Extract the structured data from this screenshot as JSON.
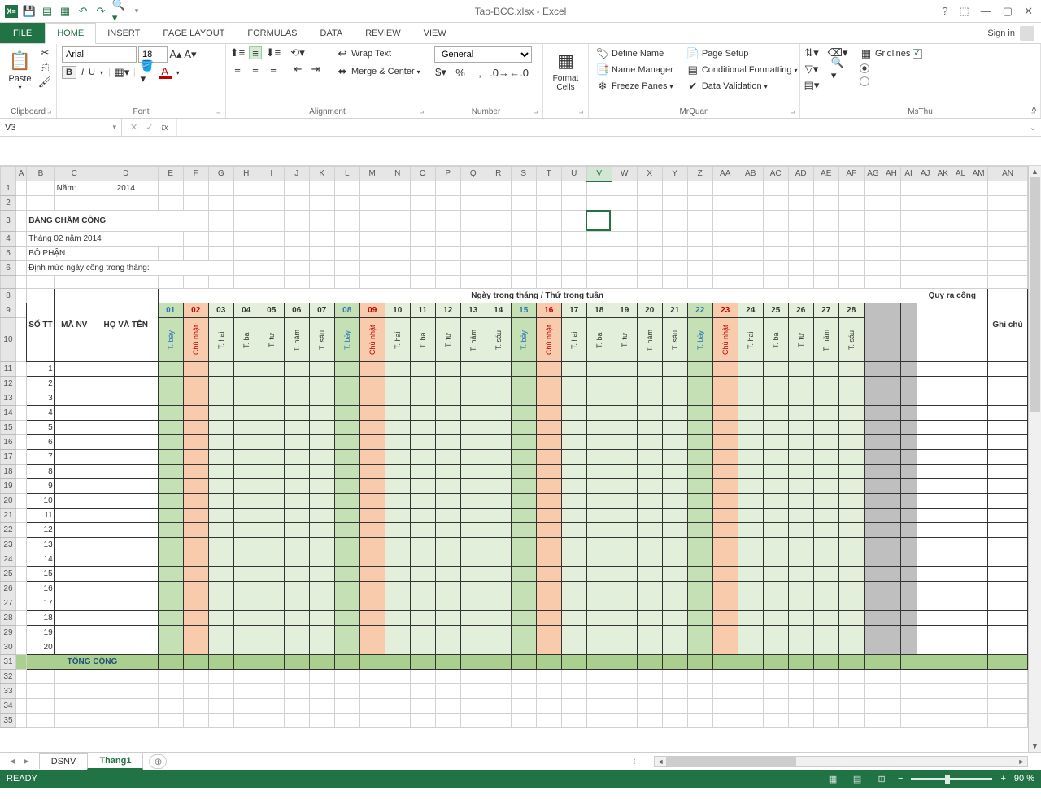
{
  "app": {
    "title": "Tao-BCC.xlsx - Excel",
    "signin": "Sign in"
  },
  "qat": {
    "save": "💾",
    "undo": "↶",
    "redo": "↷"
  },
  "tabs": [
    "FILE",
    "HOME",
    "INSERT",
    "PAGE LAYOUT",
    "FORMULAS",
    "DATA",
    "REVIEW",
    "VIEW"
  ],
  "ribbon": {
    "clipboard": {
      "label": "Clipboard",
      "paste": "Paste"
    },
    "font": {
      "label": "Font",
      "name": "Arial",
      "size": "18"
    },
    "alignment": {
      "label": "Alignment",
      "wrap": "Wrap Text",
      "merge": "Merge & Center"
    },
    "number": {
      "label": "Number",
      "format": "General"
    },
    "cells": {
      "label": "",
      "format": "Format Cells"
    },
    "mrquan": {
      "label": "MrQuan",
      "define": "Define Name",
      "mgr": "Name Manager",
      "freeze": "Freeze Panes",
      "pgsetup": "Page Setup",
      "condfmt": "Conditional Formatting",
      "dataval": "Data Validation"
    },
    "msthu": {
      "label": "MsThu",
      "grid": "Gridlines"
    }
  },
  "fbar": {
    "name": "V3",
    "fx": "fx"
  },
  "sheet": {
    "cols": [
      "A",
      "B",
      "C",
      "D",
      "E",
      "F",
      "G",
      "H",
      "I",
      "J",
      "K",
      "L",
      "M",
      "N",
      "O",
      "P",
      "Q",
      "R",
      "S",
      "T",
      "U",
      "V",
      "W",
      "X",
      "Y",
      "Z",
      "AA",
      "AB",
      "AC",
      "AD",
      "AE",
      "AF",
      "AG",
      "AH",
      "AI",
      "AJ",
      "AK",
      "AL",
      "AM",
      "AN"
    ],
    "r1_nam": "Năm:",
    "r1_year": "2014",
    "title": "BẢNG CHẤM CÔNG",
    "subtitle": "Tháng 02 năm 2014",
    "bophan": "BỘ PHẬN",
    "dinhmuc": "Định mức ngày công trong tháng:",
    "hdr_daymonth": "Ngày trong tháng / Thứ trong tuần",
    "hdr_quy": "Quy ra công",
    "hdr_stt": "SỐ TT",
    "hdr_manv": "MÃ NV",
    "hdr_hoten": "HỌ VÀ TÊN",
    "hdr_ghichu": "Ghi chú",
    "days": [
      {
        "n": "01",
        "t": "T. bảy",
        "cls": "sat"
      },
      {
        "n": "02",
        "t": "Chủ nhật",
        "cls": "sun"
      },
      {
        "n": "03",
        "t": "T. hai",
        "cls": "wd"
      },
      {
        "n": "04",
        "t": "T. ba",
        "cls": "wd"
      },
      {
        "n": "05",
        "t": "T. tư",
        "cls": "wd"
      },
      {
        "n": "06",
        "t": "T. năm",
        "cls": "wd"
      },
      {
        "n": "07",
        "t": "T. sáu",
        "cls": "wd"
      },
      {
        "n": "08",
        "t": "T. bảy",
        "cls": "sat"
      },
      {
        "n": "09",
        "t": "Chủ nhật",
        "cls": "sun"
      },
      {
        "n": "10",
        "t": "T. hai",
        "cls": "wd"
      },
      {
        "n": "11",
        "t": "T. ba",
        "cls": "wd"
      },
      {
        "n": "12",
        "t": "T. tư",
        "cls": "wd"
      },
      {
        "n": "13",
        "t": "T. năm",
        "cls": "wd"
      },
      {
        "n": "14",
        "t": "T. sáu",
        "cls": "wd"
      },
      {
        "n": "15",
        "t": "T. bảy",
        "cls": "sat"
      },
      {
        "n": "16",
        "t": "Chủ nhật",
        "cls": "sun"
      },
      {
        "n": "17",
        "t": "T. hai",
        "cls": "wd"
      },
      {
        "n": "18",
        "t": "T. ba",
        "cls": "wd"
      },
      {
        "n": "19",
        "t": "T. tư",
        "cls": "wd"
      },
      {
        "n": "20",
        "t": "T. năm",
        "cls": "wd"
      },
      {
        "n": "21",
        "t": "T. sáu",
        "cls": "wd"
      },
      {
        "n": "22",
        "t": "T. bảy",
        "cls": "sat"
      },
      {
        "n": "23",
        "t": "Chủ nhật",
        "cls": "sun"
      },
      {
        "n": "24",
        "t": "T. hai",
        "cls": "wd"
      },
      {
        "n": "25",
        "t": "T. ba",
        "cls": "wd"
      },
      {
        "n": "26",
        "t": "T. tư",
        "cls": "wd"
      },
      {
        "n": "27",
        "t": "T. năm",
        "cls": "wd"
      },
      {
        "n": "28",
        "t": "T. sáu",
        "cls": "wd"
      }
    ],
    "tong": "TỔNG CỘNG",
    "rows_data": [
      "1",
      "2",
      "3",
      "4",
      "5",
      "6",
      "7",
      "8",
      "9",
      "10",
      "11",
      "12",
      "13",
      "14",
      "15",
      "16",
      "17",
      "18",
      "19",
      "20"
    ],
    "tabs": [
      "DSNV",
      "Thang1"
    ]
  },
  "status": {
    "ready": "READY",
    "zoom": "90 %"
  }
}
